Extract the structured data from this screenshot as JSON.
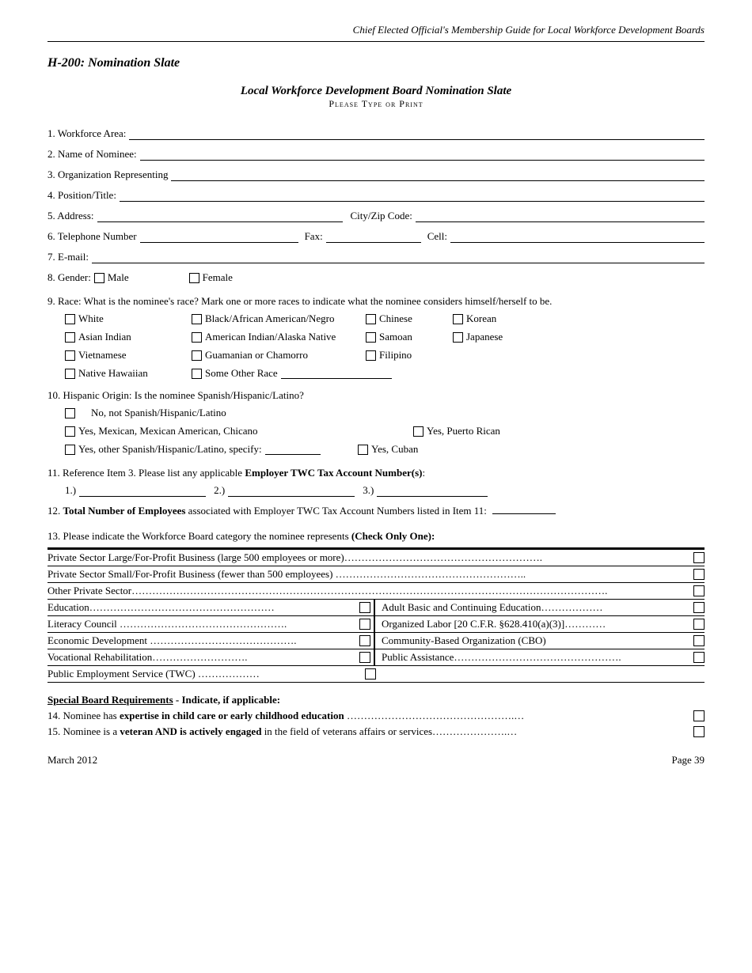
{
  "header": {
    "title": "Chief Elected Official's Membership Guide for Local Workforce Development Boards"
  },
  "section": {
    "title": "H-200: Nomination Slate"
  },
  "form": {
    "title": "Local Workforce Development Board Nomination Slate",
    "subtitle": "Please Type or Print"
  },
  "fields": {
    "workforce_area_label": "1.  Workforce Area:",
    "nominee_name_label": "2.  Name of Nominee:",
    "org_representing_label": "3.  Organization Representing",
    "position_title_label": "4.  Position/Title:",
    "address_label": "5.  Address:",
    "city_zip_label": "City/Zip Code:",
    "telephone_label": "6.  Telephone Number",
    "fax_label": "Fax:",
    "cell_label": "Cell:",
    "email_label": "7.  E-mail:",
    "gender_label": "8.  Gender:",
    "male_label": "Male",
    "female_label": "Female"
  },
  "race": {
    "question": "9.  Race: What is the nominee's race? Mark one or more races to indicate what the nominee considers himself/herself to be.",
    "options": [
      {
        "col1": "White",
        "col2": "Black/African American/Negro",
        "col3": "Chinese",
        "col4": "Korean"
      },
      {
        "col1": "Asian Indian",
        "col2": "American Indian/Alaska Native",
        "col3": "Samoan",
        "col4": "Japanese"
      },
      {
        "col1": "Vietnamese",
        "col2": "Guamanian or Chamorro",
        "col3": "Filipino",
        "col4": ""
      },
      {
        "col1": "Native Hawaiian",
        "col2": "Some Other Race",
        "col3": "",
        "col4": ""
      }
    ]
  },
  "hispanic": {
    "question": "10. Hispanic Origin:  Is the nominee Spanish/Hispanic/Latino?",
    "options": [
      {
        "label": "No, not Spanish/Hispanic/Latino",
        "right": ""
      },
      {
        "label": "Yes, Mexican, Mexican American, Chicano",
        "right": "Yes, Puerto Rican"
      },
      {
        "label": "Yes, other Spanish/Hispanic/Latino, specify:________",
        "right": "Yes, Cuban"
      }
    ]
  },
  "twc": {
    "item11_label": "11. Reference Item 3.  Please list any applicable",
    "item11_bold": "Employer TWC Tax Account Number(s)",
    "item11_colon": ":",
    "num1": "1.)",
    "num2": "2.)",
    "num3": "3.)",
    "item12": "12.",
    "item12_bold": "Total Number of Employees",
    "item12_rest": "associated with Employer TWC Tax Account Numbers listed in Item 11:"
  },
  "item13": {
    "label": "13. Please indicate the Workforce Board category the nominee represents",
    "bold": "(Check Only One):"
  },
  "categories": [
    {
      "type": "full",
      "text": "Private Sector Large/For-Profit Business (large 500 employees or more)",
      "dots": ".............................................."
    },
    {
      "type": "full",
      "text": "Private Sector Small/For-Profit Business (fewer than 500 employees)",
      "dots": ".............................................."
    },
    {
      "type": "full",
      "text": "Other Private Sector",
      "dots": "..............................................................................................................................................."
    },
    {
      "type": "split",
      "left_text": "Education",
      "left_dots": "…………………………………………….…",
      "right_text": "Adult Basic and Continuing Education",
      "right_dots": "......................"
    },
    {
      "type": "split",
      "left_text": "Literacy Council ………………………………………….",
      "left_dots": "",
      "right_text": "Organized Labor [20 C.F.R. §628.410(a)(3)]",
      "right_dots": ".........."
    },
    {
      "type": "split",
      "left_text": "Economic Development …………………………………….",
      "left_dots": "",
      "right_text": "Community-Based Organization (CBO)",
      "right_dots": ""
    },
    {
      "type": "split",
      "left_text": "Vocational Rehabilitation……………………….",
      "left_dots": "",
      "right_text": "Public Assistance",
      "right_dots": ".................................................."
    },
    {
      "type": "split_last",
      "left_text": "Public Employment Service (TWC) ……………….",
      "left_dots": ""
    }
  ],
  "special": {
    "header": "Special Board Requirements",
    "header_rest": " - Indicate, if applicable:",
    "item14_pre": "14. Nominee has ",
    "item14_bold": "expertise in child care or early childhood education",
    "item14_dots": " ………………………………………….…",
    "item15_pre": "15. Nominee is a ",
    "item15_bold": "veteran AND is actively engaged",
    "item15_rest": " in the field of veterans affairs or services………………….…"
  },
  "footer": {
    "left": "March 2012",
    "right": "Page 39"
  }
}
